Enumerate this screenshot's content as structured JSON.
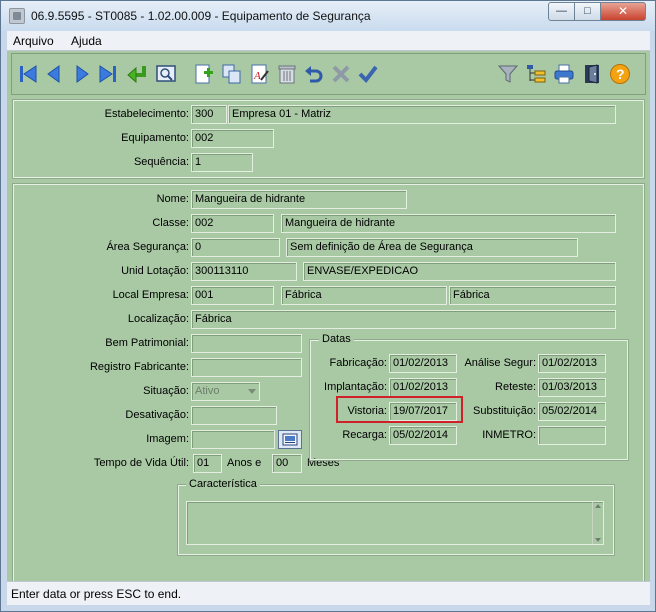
{
  "window": {
    "title": "06.9.5595 - ST0085 - 1.02.00.009 - Equipamento de Segurança",
    "minimize_glyph": "—",
    "maximize_glyph": "□",
    "close_glyph": "✕"
  },
  "menu": {
    "arquivo": "Arquivo",
    "ajuda": "Ajuda"
  },
  "toolbar": {
    "icons": [
      "first-record-icon",
      "previous-record-icon",
      "next-record-icon",
      "last-record-icon",
      "return-icon",
      "zoom-icon",
      "new-record-icon",
      "copy-icon",
      "edit-icon",
      "delete-icon",
      "undo-icon",
      "cancel-icon",
      "confirm-icon",
      "filter-icon",
      "tree-icon",
      "print-icon",
      "exit-icon",
      "help-icon"
    ]
  },
  "header": {
    "estabelecimento_label": "Estabelecimento:",
    "estabelecimento_code": "300",
    "estabelecimento_name": "Empresa 01 - Matriz",
    "equipamento_label": "Equipamento:",
    "equipamento_value": "002",
    "sequencia_label": "Sequência:",
    "sequencia_value": "1"
  },
  "detail": {
    "nome_label": "Nome:",
    "nome_value": "Mangueira de hidrante",
    "classe_label": "Classe:",
    "classe_code": "002",
    "classe_name": "Mangueira de hidrante",
    "area_label": "Área Segurança:",
    "area_code": "0",
    "area_name": "Sem definição de Área de Segurança",
    "unid_label": "Unid Lotação:",
    "unid_code": "300113110",
    "unid_name": "ENVASE/EXPEDICAO",
    "local_label": "Local Empresa:",
    "local_code": "001",
    "local_name1": "Fábrica",
    "local_name2": "Fábrica",
    "localizacao_label": "Localização:",
    "localizacao_value": "Fábrica",
    "bem_label": "Bem Patrimonial:",
    "bem_value": "",
    "registro_label": "Registro Fabricante:",
    "registro_value": "",
    "situacao_label": "Situação:",
    "situacao_value": "Ativo",
    "desativacao_label": "Desativação:",
    "desativacao_value": "",
    "imagem_label": "Imagem:",
    "imagem_value": "",
    "vida_label": "Tempo de Vida Útil:",
    "vida_anos": "01",
    "anos_e_label": "Anos e",
    "vida_meses": "00",
    "meses_label": "Meses"
  },
  "datas": {
    "title": "Datas",
    "fabricacao_label": "Fabricação:",
    "fabricacao_value": "01/02/2013",
    "implantacao_label": "Implantação:",
    "implantacao_value": "01/02/2013",
    "vistoria_label": "Vistoria:",
    "vistoria_value": "19/07/2017",
    "recarga_label": "Recarga:",
    "recarga_value": "05/02/2014",
    "analise_label": "Análise Segur:",
    "analise_value": "01/02/2013",
    "reteste_label": "Reteste:",
    "reteste_value": "01/03/2013",
    "substituicao_label": "Substituição:",
    "substituicao_value": "05/02/2014",
    "inmetro_label": "INMETRO:",
    "inmetro_value": "",
    "highlight_color": "#d0202a"
  },
  "caracteristica": {
    "title": "Característica",
    "value": ""
  },
  "status": {
    "text": "Enter data or press ESC to end."
  }
}
